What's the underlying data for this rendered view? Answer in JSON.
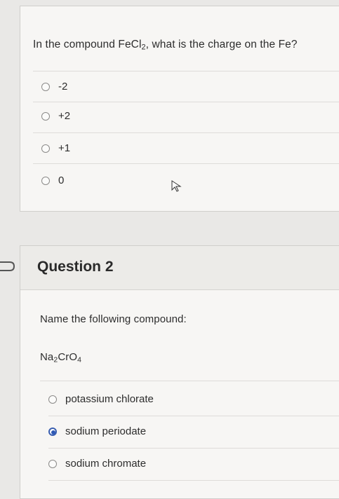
{
  "question1": {
    "prompt_before": "In the compound FeCl",
    "prompt_sub": "2",
    "prompt_after": ", what is the charge on the Fe?",
    "options": [
      {
        "label": "-2",
        "selected": false
      },
      {
        "label": "+2",
        "selected": false
      },
      {
        "label": "+1",
        "selected": false
      },
      {
        "label": "0",
        "selected": false
      }
    ]
  },
  "question2": {
    "title": "Question 2",
    "prompt": "Name the following compound:",
    "formula": {
      "p1": "Na",
      "s1": "2",
      "p2": "CrO",
      "s2": "4"
    },
    "options": [
      {
        "label": "potassium chlorate",
        "selected": false
      },
      {
        "label": "sodium periodate",
        "selected": true
      },
      {
        "label": "sodium chromate",
        "selected": false
      }
    ]
  },
  "colors": {
    "radio_selected": "#2e59b5",
    "background": "#e9e8e6",
    "card": "#f7f6f4"
  },
  "icons": [
    "chevron-right-icon",
    "cursor-icon"
  ]
}
